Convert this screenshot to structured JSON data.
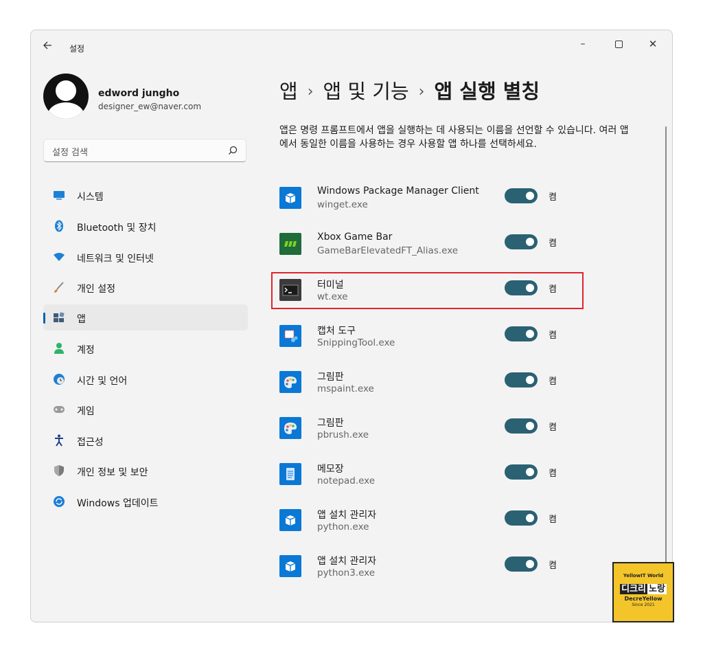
{
  "window": {
    "title": "설정",
    "back_icon": "arrow-left-icon"
  },
  "user": {
    "name": "edword jungho",
    "email": "designer_ew@naver.com"
  },
  "search": {
    "placeholder": "설정 검색"
  },
  "sidebar": {
    "items": [
      {
        "label": "시스템",
        "icon": "system-icon",
        "color": "#1e7fd6"
      },
      {
        "label": "Bluetooth 및 장치",
        "icon": "bluetooth-icon",
        "color": "#1e7fd6"
      },
      {
        "label": "네트워크 및 인터넷",
        "icon": "wifi-icon",
        "color": "#1e7fd6"
      },
      {
        "label": "개인 설정",
        "icon": "brush-icon",
        "color": "#d4803a"
      },
      {
        "label": "앱",
        "icon": "apps-icon",
        "color": "#3f5a7a",
        "active": true
      },
      {
        "label": "계정",
        "icon": "account-icon",
        "color": "#2fb36b"
      },
      {
        "label": "시간 및 언어",
        "icon": "clock-globe-icon",
        "color": "#1e7fd6"
      },
      {
        "label": "게임",
        "icon": "gamepad-icon",
        "color": "#8a8a8a"
      },
      {
        "label": "접근성",
        "icon": "accessibility-icon",
        "color": "#1a3f8a"
      },
      {
        "label": "개인 정보 및 보안",
        "icon": "shield-icon",
        "color": "#6f6f6f"
      },
      {
        "label": "Windows 업데이트",
        "icon": "update-icon",
        "color": "#1e7fd6"
      }
    ]
  },
  "breadcrumb": {
    "part1": "앱",
    "part2": "앱 및 기능",
    "current": "앱 실행 별칭",
    "separator": "›"
  },
  "description": "앱은 명령 프롬프트에서 앱을 실행하는 데 사용되는 이름을 선언할 수 있습니다. 여러 앱에서 동일한 이름을 사용하는 경우 사용할 앱 하나를 선택하세요.",
  "aliases": [
    {
      "name": "Windows Package Manager Client",
      "exe": "winget.exe",
      "state": "켬",
      "on": true,
      "icon": "package-box-icon"
    },
    {
      "name": "Xbox Game Bar",
      "exe": "GameBarElevatedFT_Alias.exe",
      "state": "켬",
      "on": true,
      "icon": "game-bar-icon"
    },
    {
      "name": "터미널",
      "exe": "wt.exe",
      "state": "켬",
      "on": true,
      "icon": "terminal-icon"
    },
    {
      "name": "캡처 도구",
      "exe": "SnippingTool.exe",
      "state": "켬",
      "on": true,
      "icon": "snipping-tool-icon"
    },
    {
      "name": "그림판",
      "exe": "mspaint.exe",
      "state": "켬",
      "on": true,
      "icon": "paint-palette-icon"
    },
    {
      "name": "그림판",
      "exe": "pbrush.exe",
      "state": "켬",
      "on": true,
      "icon": "paint-palette-icon"
    },
    {
      "name": "메모장",
      "exe": "notepad.exe",
      "state": "켬",
      "on": true,
      "icon": "notepad-icon"
    },
    {
      "name": "앱 설치 관리자",
      "exe": "python.exe",
      "state": "켬",
      "on": true,
      "icon": "package-box-icon"
    },
    {
      "name": "앱 설치 관리자",
      "exe": "python3.exe",
      "state": "켬",
      "on": true,
      "icon": "package-box-icon"
    }
  ],
  "watermark": {
    "line1": "YellowIT World",
    "line2a": "디크리",
    "line2b": "노랑",
    "line3": "DecreYellow",
    "line4": "Since 2021"
  },
  "colors": {
    "toggle_on": "#2a6173",
    "accent": "#0a5fb4",
    "highlight_border": "#e0242b",
    "app_tile": "#0a78d4"
  }
}
